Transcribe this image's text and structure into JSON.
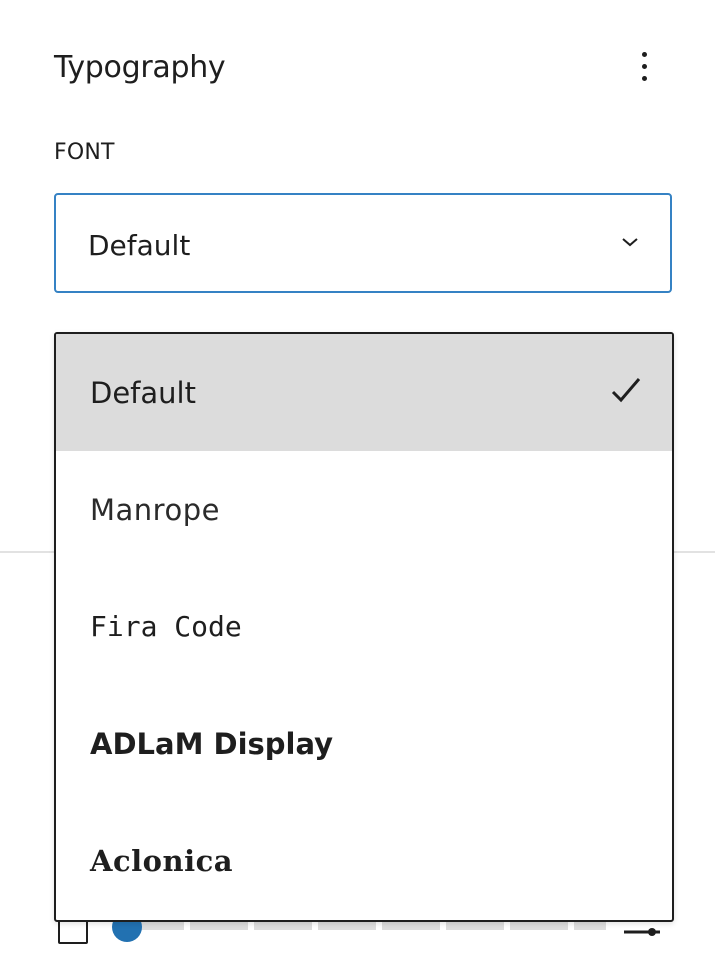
{
  "panel": {
    "title": "Typography",
    "options_icon": "more-vertical-icon"
  },
  "font_field": {
    "label": "FONT",
    "selected_value": "Default",
    "chevron_icon": "chevron-down-icon",
    "focus_color": "#3582c4"
  },
  "dropdown": {
    "options": [
      {
        "label": "Default",
        "selected": true,
        "check_icon": "checkmark-icon"
      },
      {
        "label": "Manrope",
        "selected": false
      },
      {
        "label": "Fira Code",
        "selected": false
      },
      {
        "label": "ADLaM Display",
        "selected": false
      },
      {
        "label": "Aclonica",
        "selected": false
      }
    ],
    "selected_bg": "#dcdcdc"
  },
  "background_controls": {
    "slider_thumb_color": "#2271b1"
  }
}
